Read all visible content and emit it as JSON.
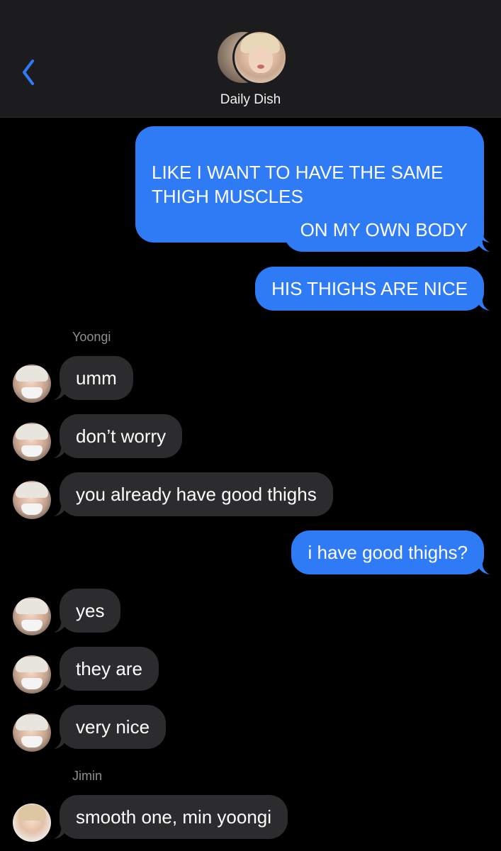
{
  "header": {
    "title": "Daily Dish"
  },
  "messages": {
    "m1": "LIKE I WANT TO HAVE THE SAME\nTHIGH MUSCLES",
    "m2": "ON MY OWN BODY",
    "m3": "HIS THIGHS ARE NICE",
    "sender_yoongi": "Yoongi",
    "m4": "umm",
    "m5": "don’t worry",
    "m6": "you already have good thighs",
    "m7": "i have good thighs?",
    "m8": "yes",
    "m9": "they are",
    "m10": "very nice",
    "sender_jimin": "Jimin",
    "m11": "smooth one, min yoongi"
  },
  "colors": {
    "sent_bubble": "#2f7bf6",
    "received_bubble": "#2c2c2e",
    "accent": "#2f7bf6"
  }
}
